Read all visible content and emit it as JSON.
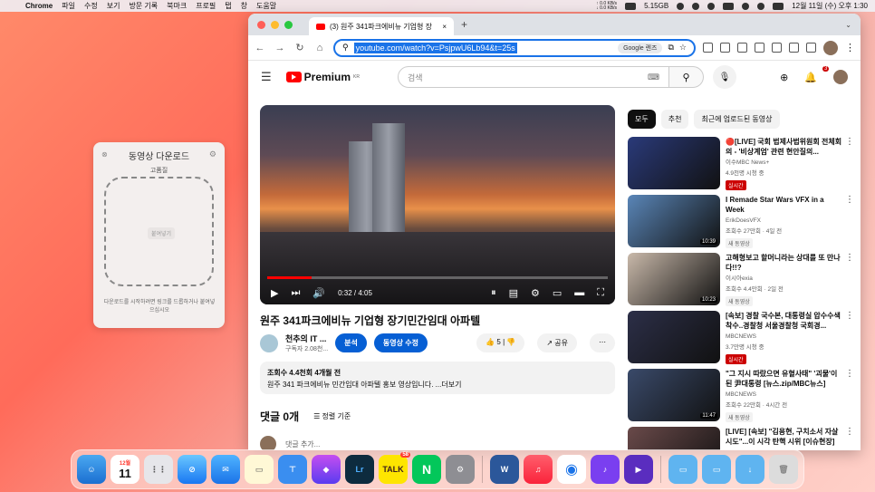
{
  "menubar": {
    "app": "Chrome",
    "items": [
      "파일",
      "수정",
      "보기",
      "방문 기록",
      "북마크",
      "프로필",
      "탭",
      "창",
      "도움말"
    ],
    "net_up": "0.0 KB/s",
    "net_down": "0.0 KB/s",
    "memory": "5.15GB",
    "datetime": "12월 11일 (수) 오후 1:30"
  },
  "downloader": {
    "title": "동영상 다운로드",
    "quality": "고품질",
    "paste_label": "붙여넣기",
    "hint": "다운로드를 시작하려면 링크를 드롭하거나 붙여넣으십시오"
  },
  "browser": {
    "tab_title": "(3) 원주 341파크에비뉴 기업형 장",
    "url": "youtube.com/watch?v=PsjpwU6Lb94&t=25s",
    "lens_label": "Google 렌즈"
  },
  "youtube": {
    "logo": "Premium",
    "logo_region": "KR",
    "search_placeholder": "검색",
    "notif_count": "3",
    "player": {
      "time": "0:32 / 4:05",
      "progress": 0.13
    },
    "video_title": "원주 341파크에비뉴 기업형 장기민간임대 아파텔",
    "channel_name": "천추의 IT ...",
    "channel_subs": "구독자 2.08천...",
    "analysis_label": "분석",
    "edit_label": "동영상 수정",
    "like_count": "5",
    "share_label": "공유",
    "views_line": "조회수 4.4천회  4개월 전",
    "description": "원주 341 파크에비뉴 민간임대 아파텔 홍보 영상입니다. ...더보기",
    "comments_count": "댓글 0개",
    "sort_label": "정렬 기준",
    "add_comment": "댓글 추가...",
    "chips": [
      "모두",
      "추천",
      "최근에 업로드된 동영상"
    ],
    "recommendations": [
      {
        "title": "🔴[LIVE] 국회 법제사법위원회 전체회의 - '비상계엄' 관련 현안질의...",
        "channel": "이수MBC News+",
        "meta": "4.9천명 시청 중",
        "tag": "실시간",
        "live": true,
        "duration": "",
        "thumb_color": "#2a3a7a"
      },
      {
        "title": "I Remade Star Wars VFX in a Week",
        "channel": "ErikDoesVFX",
        "meta": "조회수 27만회 · 4일 전",
        "tag": "새 동영상",
        "live": false,
        "duration": "10:39",
        "thumb_color": "#5a86b8"
      },
      {
        "title": "고해형보고 할머니라는 상대를 또 만나다!!?",
        "channel": "이시아exia",
        "meta": "조회수 4.4만회 · 2일 전",
        "tag": "새 동영상",
        "live": false,
        "duration": "10:23",
        "thumb_color": "#c9b9aa"
      },
      {
        "title": "[속보] 경찰 국수본, 대통령실 압수수색 착수..경찰청 서울경찰청 국회경...",
        "channel": "MBCNEWS",
        "meta": "3.7만명 시청 중",
        "tag": "실시간",
        "live": true,
        "duration": "",
        "thumb_color": "#2c2f48"
      },
      {
        "title": "\"그 지시 따랐으면 유혈사태\" '괴물'이 된 尹대통령 [뉴스.zip/MBC뉴스]",
        "channel": "MBCNEWS",
        "meta": "조회수 22만회 · 4시간 전",
        "tag": "새 동영상",
        "live": false,
        "duration": "11:47",
        "thumb_color": "#3a4a6a"
      },
      {
        "title": "[LIVE] [속보] \"김용현, 구치소서 자살 시도\"...이 시각 탄핵 시위 [이슈현장] /...",
        "channel": "",
        "meta": "",
        "tag": "",
        "live": true,
        "duration": "",
        "thumb_color": "#6a4a4a"
      }
    ]
  },
  "dock": {
    "calendar_month": "12월",
    "calendar_day": "11",
    "talk_badge": "58",
    "talk_label": "TALK",
    "lr_label": "Lr",
    "word_label": "W"
  }
}
